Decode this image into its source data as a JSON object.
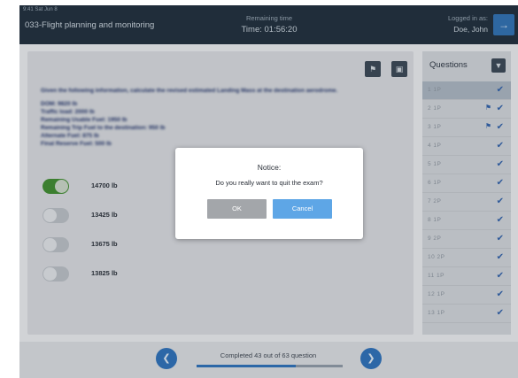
{
  "status_bar": {
    "time": "9:41 Sat Jun 8"
  },
  "header": {
    "app_title": "033-Flight planning and monitoring",
    "timer_label": "Remaining time",
    "timer_value": "Time: 01:56:20",
    "user_label": "Logged in as:",
    "user_name": "Doe, John",
    "logout_icon": "arrow-right-icon"
  },
  "question": {
    "text": "Given the following information, calculate the revised estimated Landing Mass at the destination aerodrome.",
    "data_lines": [
      "DOM: 9820 lb",
      "Traffic load: 2000 lb",
      "Remaining Usable Fuel: 1950 lb",
      "Remaining Trip Fuel to the destination: 950 lb",
      "Alternate Fuel: 875 lb",
      "Final Reserve Fuel: 500 lb"
    ],
    "options": [
      {
        "label": "14700 lb",
        "selected": true
      },
      {
        "label": "13425 lb",
        "selected": false
      },
      {
        "label": "13675 lb",
        "selected": false
      },
      {
        "label": "13825 lb",
        "selected": false
      }
    ]
  },
  "sidebar": {
    "title": "Questions",
    "items": [
      {
        "num": "1  1P",
        "active": true,
        "flag": false,
        "answered": true
      },
      {
        "num": "2  1P",
        "active": false,
        "flag": true,
        "answered": true
      },
      {
        "num": "3  1P",
        "active": false,
        "flag": true,
        "answered": true
      },
      {
        "num": "4  1P",
        "active": false,
        "flag": false,
        "answered": true
      },
      {
        "num": "5  1P",
        "active": false,
        "flag": false,
        "answered": true
      },
      {
        "num": "6  1P",
        "active": false,
        "flag": false,
        "answered": true
      },
      {
        "num": "7  2P",
        "active": false,
        "flag": false,
        "answered": true
      },
      {
        "num": "8  1P",
        "active": false,
        "flag": false,
        "answered": true
      },
      {
        "num": "9  2P",
        "active": false,
        "flag": false,
        "answered": true
      },
      {
        "num": "10  2P",
        "active": false,
        "flag": false,
        "answered": true
      },
      {
        "num": "11  1P",
        "active": false,
        "flag": false,
        "answered": true
      },
      {
        "num": "12  1P",
        "active": false,
        "flag": false,
        "answered": true
      },
      {
        "num": "13  1P",
        "active": false,
        "flag": false,
        "answered": true
      }
    ]
  },
  "footer": {
    "progress_text": "Completed 43 out of 63 question",
    "progress_fraction": 0.68
  },
  "modal": {
    "title": "Notice:",
    "message": "Do you really want to quit the exam?",
    "ok_label": "OK",
    "cancel_label": "Cancel"
  },
  "colors": {
    "header_bg": "#1f2d3b",
    "accent_blue": "#2d6fb7",
    "toggle_on": "#3f8a2f",
    "cancel_button": "#5ea6e6",
    "ok_button": "#a3a6aa"
  }
}
